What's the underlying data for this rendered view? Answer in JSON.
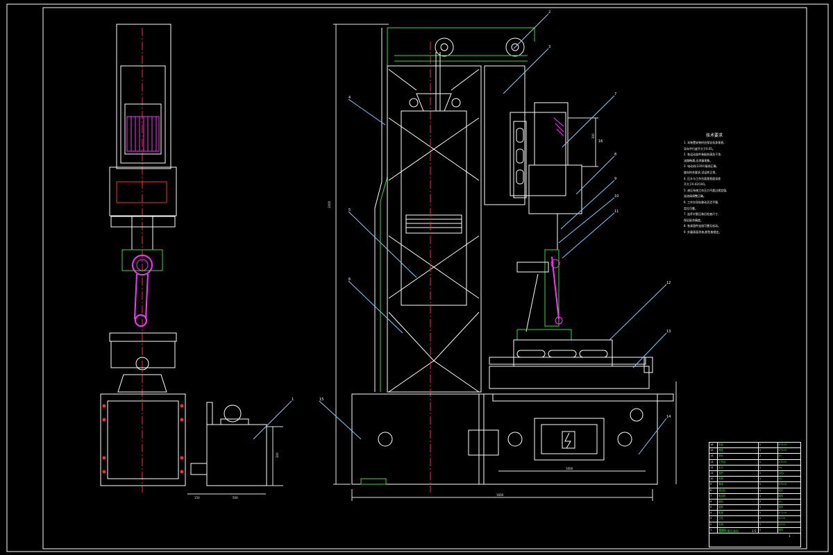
{
  "drawing": {
    "colors": {
      "background": "#000000",
      "outline": "#ffffff",
      "centerline": "#ff2a2a",
      "dimension": "#e8e8e8",
      "part_green": "#2fe02f",
      "magenta": "#ff33ff",
      "leader": "#7fd0ff",
      "yellow": "#ffff33"
    },
    "part_numbers": [
      "1",
      "2",
      "3",
      "4",
      "5",
      "6",
      "7",
      "8",
      "9",
      "10",
      "11",
      "12",
      "13",
      "14",
      "15",
      "16"
    ],
    "dimensions": {
      "overall_height": "2000",
      "motor_height": "300",
      "base_width": "1600",
      "table_width": "1000",
      "pump_height": "300",
      "pump_offset": "150",
      "pump_width": "500"
    }
  },
  "tech_notes": {
    "title": "技术要求",
    "lines": [
      "1. 本装置安装时应保证机身垂直,",
      "   导向平行度不大于0.05。",
      "2. 各运动部件装配前清洗干净,",
      "   油路畅通,无渗漏现象。",
      "3. 电动机(220V)接线正确,",
      "   旋向符合要求,试运转正常。",
      "4. 压头与工作台面垂直度误差",
      "   不大于0.02/100。",
      "5. 液压系统工作压力不超过规定值,",
      "   溢流阀调整正确。",
      "6. 工作台导轨移动灵活平稳,",
      "   定位可靠。",
      "7. 连杆衬套压装后检查尺寸,",
      "   保证配合精度。",
      "8. 各紧固件连接可靠无松动。",
      "9. 外露表面涂漆,颜色按规定。"
    ]
  },
  "bom": {
    "rows": [
      {
        "no": "16",
        "name": "机架",
        "qty": "1",
        "mat": "HT200"
      },
      {
        "no": "15",
        "name": "底座",
        "qty": "1",
        "mat": "HT200"
      },
      {
        "no": "14",
        "name": "导轨",
        "qty": "2",
        "mat": "45"
      },
      {
        "no": "13",
        "name": "工作台",
        "qty": "1",
        "mat": "HT200"
      },
      {
        "no": "12",
        "name": "压头",
        "qty": "1",
        "mat": "45"
      },
      {
        "no": "11",
        "name": "连杆",
        "qty": "1",
        "mat": "40Cr"
      },
      {
        "no": "10",
        "name": "夹具",
        "qty": "1",
        "mat": "45"
      },
      {
        "no": "9",
        "name": "滑块",
        "qty": "1",
        "mat": "HT200"
      },
      {
        "no": "8",
        "name": "液压缸",
        "qty": "1",
        "mat": "组件"
      },
      {
        "no": "7",
        "name": "电动机",
        "qty": "1",
        "mat": "组件"
      },
      {
        "no": "6",
        "name": "链轮",
        "qty": "2",
        "mat": "45"
      },
      {
        "no": "5",
        "name": "链条",
        "qty": "1",
        "mat": "组件"
      },
      {
        "no": "4",
        "name": "配重",
        "qty": "1",
        "mat": "HT150"
      },
      {
        "no": "3",
        "name": "立柱",
        "qty": "1",
        "mat": "Q235"
      },
      {
        "no": "2",
        "name": "支架",
        "qty": "1",
        "mat": "Q235"
      },
      {
        "no": "1",
        "name": "液压站",
        "qty": "1",
        "mat": "组件"
      }
    ]
  },
  "title_block": {
    "name": "连杆衬套压装机",
    "scale": "1:5",
    "sheet": "1"
  }
}
